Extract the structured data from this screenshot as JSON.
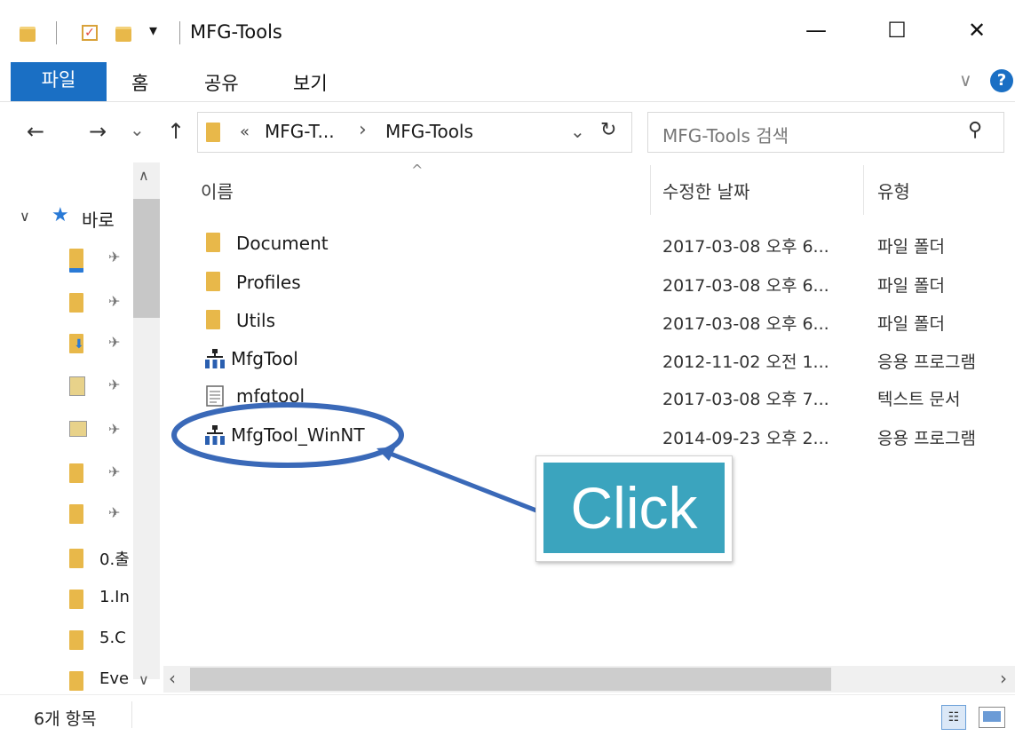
{
  "titlebar": {
    "title": "MFG-Tools",
    "minimize": "—",
    "maximize": "☐",
    "close": "✕",
    "qa_dropdown": "▾"
  },
  "ribbon": {
    "tabs": [
      {
        "label": "파일"
      },
      {
        "label": "홈"
      },
      {
        "label": "공유"
      },
      {
        "label": "보기"
      }
    ],
    "expand": "∨",
    "help": "?"
  },
  "nav": {
    "back": "←",
    "forward": "→",
    "recent": "⌄",
    "up": "↑",
    "breadcrumb_prefix": "«",
    "crumb1": "MFG-T...",
    "crumb_sep": "›",
    "crumb2": "MFG-Tools",
    "addr_dropdown": "⌄",
    "refresh": "↻",
    "search_placeholder": "MFG-Tools 검색",
    "search_icon": "⚲"
  },
  "sidebar": {
    "quick_access_label": "바로",
    "items": [
      {
        "label": "",
        "icon": "desktop-folder-icon"
      },
      {
        "label": "",
        "icon": "folder-icon"
      },
      {
        "label": "",
        "icon": "downloads-folder-icon"
      },
      {
        "label": "",
        "icon": "documents-folder-icon"
      },
      {
        "label": "",
        "icon": "pictures-folder-icon"
      },
      {
        "label": "",
        "icon": "folder-icon"
      },
      {
        "label": "",
        "icon": "folder-icon"
      },
      {
        "label": "0.출",
        "icon": "folder-icon"
      },
      {
        "label": "1.In",
        "icon": "folder-icon"
      },
      {
        "label": "5.C",
        "icon": "folder-icon"
      },
      {
        "label": "Eve",
        "icon": "folder-icon"
      }
    ]
  },
  "columns": {
    "name": "이름",
    "date": "수정한 날짜",
    "type": "유형",
    "sort_indicator": "^"
  },
  "files": [
    {
      "name": "Document",
      "date": "2017-03-08 오후 6...",
      "type": "파일 폴더",
      "icon": "folder-icon"
    },
    {
      "name": "Profiles",
      "date": "2017-03-08 오후 6...",
      "type": "파일 폴더",
      "icon": "folder-icon"
    },
    {
      "name": "Utils",
      "date": "2017-03-08 오후 6...",
      "type": "파일 폴더",
      "icon": "folder-icon"
    },
    {
      "name": "MfgTool",
      "date": "2012-11-02 오전 1...",
      "type": "응용 프로그램",
      "icon": "application-icon"
    },
    {
      "name": "mfgtool",
      "date": "2017-03-08 오후 7...",
      "type": "텍스트 문서",
      "icon": "text-document-icon"
    },
    {
      "name": "MfgTool_WinNT",
      "date": "2014-09-23 오후 2...",
      "type": "응용 프로그램",
      "icon": "application-icon"
    }
  ],
  "status": {
    "item_count": "6개 항목"
  },
  "annotation": {
    "callout_text": "Click",
    "highlight_color": "#3a69b8",
    "callout_color": "#3ba4be"
  }
}
